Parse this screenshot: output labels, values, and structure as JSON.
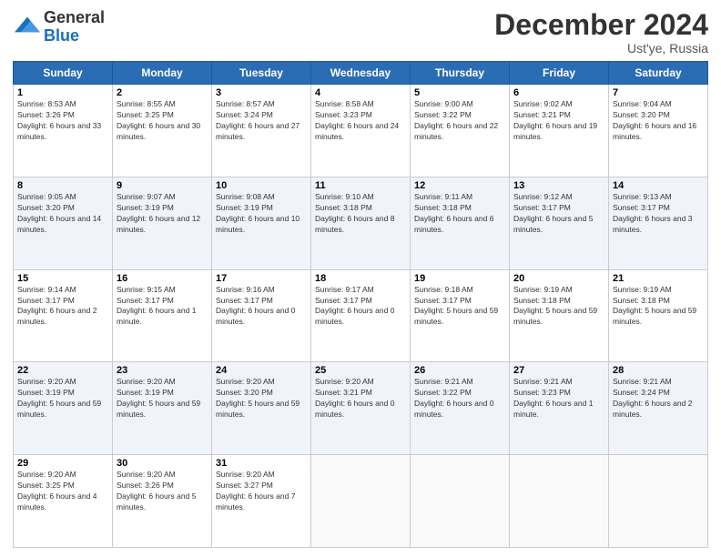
{
  "logo": {
    "line1": "General",
    "line2": "Blue"
  },
  "title": "December 2024",
  "location": "Ust'ye, Russia",
  "days_of_week": [
    "Sunday",
    "Monday",
    "Tuesday",
    "Wednesday",
    "Thursday",
    "Friday",
    "Saturday"
  ],
  "weeks": [
    [
      {
        "day": "1",
        "info": "Sunrise: 8:53 AM\nSunset: 3:26 PM\nDaylight: 6 hours and 33 minutes."
      },
      {
        "day": "2",
        "info": "Sunrise: 8:55 AM\nSunset: 3:25 PM\nDaylight: 6 hours and 30 minutes."
      },
      {
        "day": "3",
        "info": "Sunrise: 8:57 AM\nSunset: 3:24 PM\nDaylight: 6 hours and 27 minutes."
      },
      {
        "day": "4",
        "info": "Sunrise: 8:58 AM\nSunset: 3:23 PM\nDaylight: 6 hours and 24 minutes."
      },
      {
        "day": "5",
        "info": "Sunrise: 9:00 AM\nSunset: 3:22 PM\nDaylight: 6 hours and 22 minutes."
      },
      {
        "day": "6",
        "info": "Sunrise: 9:02 AM\nSunset: 3:21 PM\nDaylight: 6 hours and 19 minutes."
      },
      {
        "day": "7",
        "info": "Sunrise: 9:04 AM\nSunset: 3:20 PM\nDaylight: 6 hours and 16 minutes."
      }
    ],
    [
      {
        "day": "8",
        "info": "Sunrise: 9:05 AM\nSunset: 3:20 PM\nDaylight: 6 hours and 14 minutes."
      },
      {
        "day": "9",
        "info": "Sunrise: 9:07 AM\nSunset: 3:19 PM\nDaylight: 6 hours and 12 minutes."
      },
      {
        "day": "10",
        "info": "Sunrise: 9:08 AM\nSunset: 3:19 PM\nDaylight: 6 hours and 10 minutes."
      },
      {
        "day": "11",
        "info": "Sunrise: 9:10 AM\nSunset: 3:18 PM\nDaylight: 6 hours and 8 minutes."
      },
      {
        "day": "12",
        "info": "Sunrise: 9:11 AM\nSunset: 3:18 PM\nDaylight: 6 hours and 6 minutes."
      },
      {
        "day": "13",
        "info": "Sunrise: 9:12 AM\nSunset: 3:17 PM\nDaylight: 6 hours and 5 minutes."
      },
      {
        "day": "14",
        "info": "Sunrise: 9:13 AM\nSunset: 3:17 PM\nDaylight: 6 hours and 3 minutes."
      }
    ],
    [
      {
        "day": "15",
        "info": "Sunrise: 9:14 AM\nSunset: 3:17 PM\nDaylight: 6 hours and 2 minutes."
      },
      {
        "day": "16",
        "info": "Sunrise: 9:15 AM\nSunset: 3:17 PM\nDaylight: 6 hours and 1 minute."
      },
      {
        "day": "17",
        "info": "Sunrise: 9:16 AM\nSunset: 3:17 PM\nDaylight: 6 hours and 0 minutes."
      },
      {
        "day": "18",
        "info": "Sunrise: 9:17 AM\nSunset: 3:17 PM\nDaylight: 6 hours and 0 minutes."
      },
      {
        "day": "19",
        "info": "Sunrise: 9:18 AM\nSunset: 3:17 PM\nDaylight: 5 hours and 59 minutes."
      },
      {
        "day": "20",
        "info": "Sunrise: 9:19 AM\nSunset: 3:18 PM\nDaylight: 5 hours and 59 minutes."
      },
      {
        "day": "21",
        "info": "Sunrise: 9:19 AM\nSunset: 3:18 PM\nDaylight: 5 hours and 59 minutes."
      }
    ],
    [
      {
        "day": "22",
        "info": "Sunrise: 9:20 AM\nSunset: 3:19 PM\nDaylight: 5 hours and 59 minutes."
      },
      {
        "day": "23",
        "info": "Sunrise: 9:20 AM\nSunset: 3:19 PM\nDaylight: 5 hours and 59 minutes."
      },
      {
        "day": "24",
        "info": "Sunrise: 9:20 AM\nSunset: 3:20 PM\nDaylight: 5 hours and 59 minutes."
      },
      {
        "day": "25",
        "info": "Sunrise: 9:20 AM\nSunset: 3:21 PM\nDaylight: 6 hours and 0 minutes."
      },
      {
        "day": "26",
        "info": "Sunrise: 9:21 AM\nSunset: 3:22 PM\nDaylight: 6 hours and 0 minutes."
      },
      {
        "day": "27",
        "info": "Sunrise: 9:21 AM\nSunset: 3:23 PM\nDaylight: 6 hours and 1 minute."
      },
      {
        "day": "28",
        "info": "Sunrise: 9:21 AM\nSunset: 3:24 PM\nDaylight: 6 hours and 2 minutes."
      }
    ],
    [
      {
        "day": "29",
        "info": "Sunrise: 9:20 AM\nSunset: 3:25 PM\nDaylight: 6 hours and 4 minutes."
      },
      {
        "day": "30",
        "info": "Sunrise: 9:20 AM\nSunset: 3:26 PM\nDaylight: 6 hours and 5 minutes."
      },
      {
        "day": "31",
        "info": "Sunrise: 9:20 AM\nSunset: 3:27 PM\nDaylight: 6 hours and 7 minutes."
      },
      {
        "day": "",
        "info": ""
      },
      {
        "day": "",
        "info": ""
      },
      {
        "day": "",
        "info": ""
      },
      {
        "day": "",
        "info": ""
      }
    ]
  ]
}
